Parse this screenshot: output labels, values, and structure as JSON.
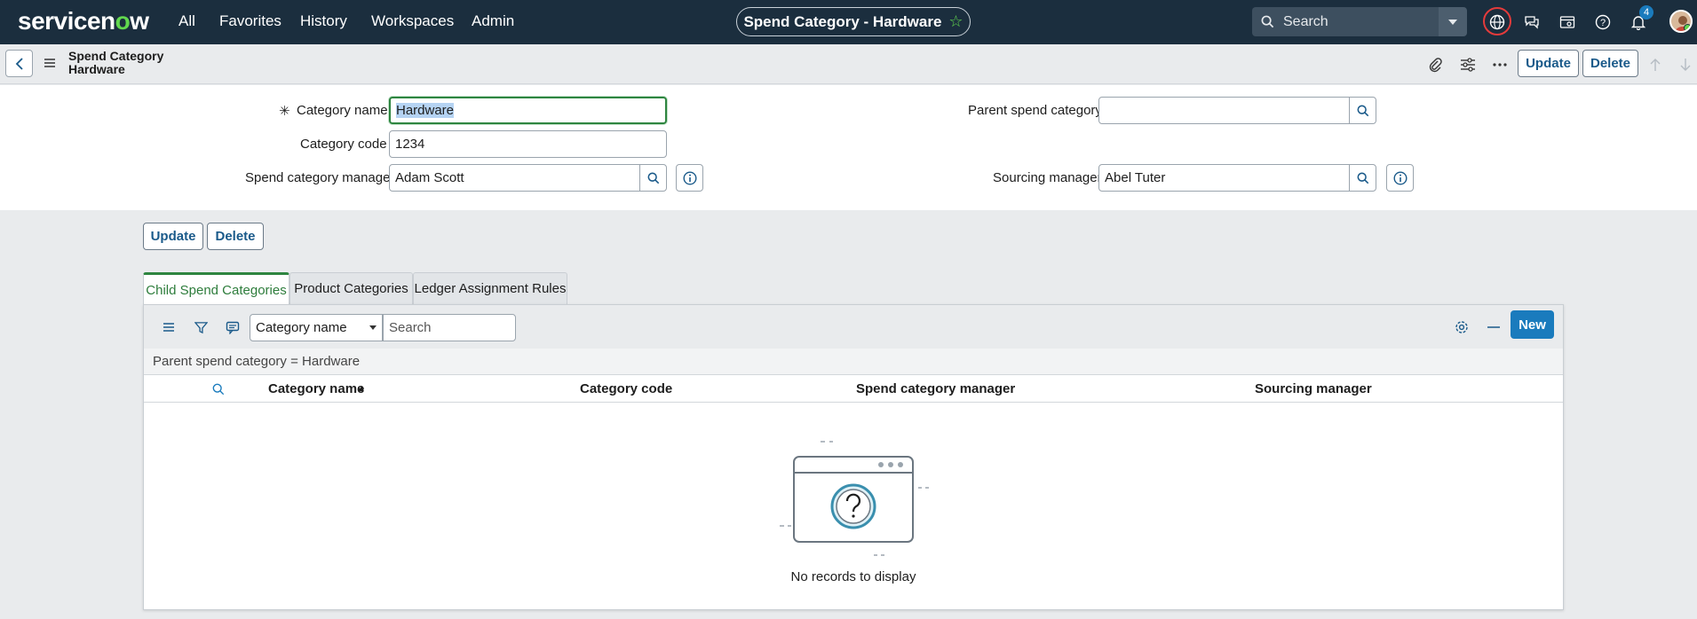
{
  "nav": {
    "brand": "servicenow",
    "links": [
      "All",
      "Favorites",
      "History",
      "Workspaces",
      "Admin"
    ],
    "record_title": "Spend Category - Hardware",
    "search_placeholder": "Search",
    "notification_count": "4"
  },
  "header": {
    "title_line1": "Spend Category",
    "title_line2": "Hardware",
    "update_label": "Update",
    "delete_label": "Delete"
  },
  "form": {
    "category_name_label": "Category name",
    "category_name_value": "Hardware",
    "category_code_label": "Category code",
    "category_code_value": "1234",
    "spend_manager_label": "Spend category manager",
    "spend_manager_value": "Adam Scott",
    "parent_label": "Parent spend category",
    "parent_value": "",
    "sourcing_label": "Sourcing manager",
    "sourcing_value": "Abel Tuter",
    "required_mark": "✳"
  },
  "actions": {
    "update_label": "Update",
    "delete_label": "Delete"
  },
  "tabs": [
    "Child Spend Categories",
    "Product Categories",
    "Ledger Assignment Rules"
  ],
  "related_list": {
    "field_select": "Category name",
    "search_placeholder": "Search",
    "new_label": "New",
    "filter_text": "Parent spend category = Hardware",
    "columns": [
      "Category name",
      "Category code",
      "Spend category manager",
      "Sourcing manager"
    ],
    "sort_indicator": "▲",
    "empty_text": "No records to display"
  },
  "colors": {
    "nav_bg": "#1b2e3e",
    "accent_green": "#62d84e",
    "primary_blue": "#1a7bbd",
    "focus_green": "#2e8540"
  }
}
